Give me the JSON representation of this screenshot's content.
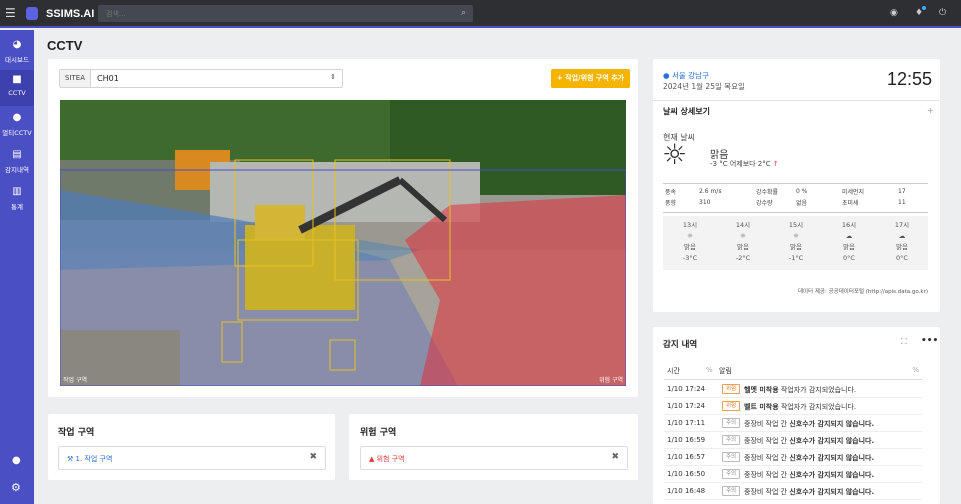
{
  "app": {
    "brand": "SSIMS.AI",
    "search_placeholder": "검색..."
  },
  "sidebar": {
    "items": [
      {
        "label": "대시보드",
        "icon": "dashboard-icon"
      },
      {
        "label": "CCTV",
        "icon": "camera-icon"
      },
      {
        "label": "멀티CCTV",
        "icon": "location-pin-icon"
      },
      {
        "label": "감지내역",
        "icon": "document-icon"
      },
      {
        "label": "통계",
        "icon": "bar-chart-icon"
      }
    ]
  },
  "page": {
    "title": "CCTV"
  },
  "cctv": {
    "site_prefix": "SITEA",
    "channel": "CH01",
    "add_button": "작업/위험 구역 추가",
    "label_work": "작업 구역",
    "label_danger": "위험 구역"
  },
  "work_zone": {
    "title": "작업 구역",
    "item": "1. 작업 구역"
  },
  "danger_zone": {
    "title": "위험 구역",
    "item": "위험 구역"
  },
  "weather": {
    "location": "서울 강남구",
    "date": "2024년 1월 25일 목요일",
    "time": "12:55",
    "detail_title": "날씨 상세보기",
    "current_label": "현재 날씨",
    "condition": "맑음",
    "temp_text": "-3 °C 어제보다 2°C",
    "stats": [
      [
        "풍속",
        "2.6 m/s",
        "강수확률",
        "0 %",
        "미세먼지",
        "17"
      ],
      [
        "풍향",
        "310",
        "강수량",
        "없음",
        "초미세",
        "11"
      ]
    ],
    "forecast": [
      {
        "hour": "13시",
        "cond": "맑음",
        "temp": "-3°C",
        "icon": "sun-icon"
      },
      {
        "hour": "14시",
        "cond": "맑음",
        "temp": "-2°C",
        "icon": "sun-icon"
      },
      {
        "hour": "15시",
        "cond": "맑음",
        "temp": "-1°C",
        "icon": "sun-icon"
      },
      {
        "hour": "16시",
        "cond": "맑음",
        "temp": "0°C",
        "icon": "cloud-icon"
      },
      {
        "hour": "17시",
        "cond": "맑음",
        "temp": "0°C",
        "icon": "cloud-icon"
      }
    ],
    "source": "데이터 제공: 공공데이터포털 (http://apis.data.go.kr)"
  },
  "alerts": {
    "title": "감지 내역",
    "col_time": "시간",
    "col_alert": "알림",
    "rows": [
      {
        "time": "1/10 17:24",
        "badge": "위험",
        "bold": "헬멧 미착용",
        "rest": " 작업자가 감지되었습니다."
      },
      {
        "time": "1/10 17:24",
        "badge": "위험",
        "bold": "벨트 미착용",
        "rest": " 작업자가 감지되었습니다."
      },
      {
        "time": "1/10 17:11",
        "badge": "주의",
        "pre": "중장비 작업 간 ",
        "bold": "신호수가 감지되지 않습니다."
      },
      {
        "time": "1/10 16:59",
        "badge": "주의",
        "pre": "중장비 작업 간 ",
        "bold": "신호수가 감지되지 않습니다."
      },
      {
        "time": "1/10 16:57",
        "badge": "주의",
        "pre": "중장비 작업 간 ",
        "bold": "신호수가 감지되지 않습니다."
      },
      {
        "time": "1/10 16:50",
        "badge": "주의",
        "pre": "중장비 작업 간 ",
        "bold": "신호수가 감지되지 않습니다."
      },
      {
        "time": "1/10 16:48",
        "badge": "주의",
        "pre": "중장비 작업 간 ",
        "bold": "신호수가 감지되지 않습니다."
      }
    ]
  },
  "colors": {
    "accent": "#4a4fc4",
    "warning": "#f5b400",
    "danger": "#e83a3a"
  }
}
